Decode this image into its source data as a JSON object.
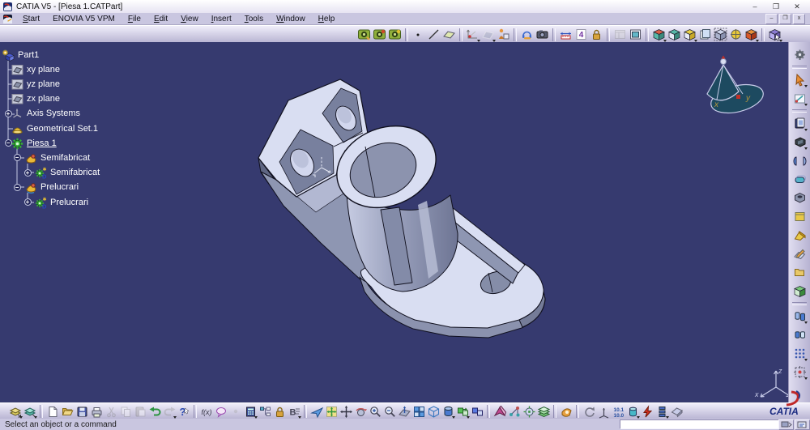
{
  "window": {
    "title": "CATIA V5 - [Piesa 1.CATPart]",
    "controls": {
      "minimize": "–",
      "restore": "❒",
      "close": "✕"
    },
    "mdi_controls": {
      "minimize": "–",
      "restore": "❒",
      "close": "x"
    }
  },
  "menubar": {
    "items": [
      {
        "label": "Start",
        "accel": 0
      },
      {
        "label": "ENOVIA V5 VPM",
        "accel": -1
      },
      {
        "label": "File",
        "accel": 0
      },
      {
        "label": "Edit",
        "accel": 0
      },
      {
        "label": "View",
        "accel": 0
      },
      {
        "label": "Insert",
        "accel": 0
      },
      {
        "label": "Tools",
        "accel": 0
      },
      {
        "label": "Window",
        "accel": 0
      },
      {
        "label": "Help",
        "accel": 0
      }
    ]
  },
  "tree": {
    "items": [
      {
        "label": "Part1",
        "depth": 0,
        "icon": "part_root"
      },
      {
        "label": "xy plane",
        "depth": 1,
        "icon": "plane_ic"
      },
      {
        "label": "yz plane",
        "depth": 1,
        "icon": "plane_ic"
      },
      {
        "label": "zx plane",
        "depth": 1,
        "icon": "plane_ic"
      },
      {
        "label": "Axis Systems",
        "depth": 1,
        "icon": "axis_ic",
        "exp": "+"
      },
      {
        "label": "Geometrical Set.1",
        "depth": 1,
        "icon": "geoset_ic"
      },
      {
        "label": "Piesa 1",
        "depth": 1,
        "icon": "gear_grn",
        "exp": "−",
        "underline": true
      },
      {
        "label": "Semifabricat",
        "depth": 2,
        "icon": "body_yel",
        "exp": "−"
      },
      {
        "label": "Semifabricat",
        "depth": 3,
        "icon": "gear_ad",
        "exp": "+"
      },
      {
        "label": "Prelucrari",
        "depth": 2,
        "icon": "body_yel2",
        "exp": "−"
      },
      {
        "label": "Prelucrari",
        "depth": 3,
        "icon": "gear_ad",
        "exp": "+"
      }
    ]
  },
  "toolbars": {
    "top": {
      "items": [
        {
          "name": "workbench-ppr",
          "glyph": "wb1"
        },
        {
          "name": "workbench-process",
          "glyph": "wb2"
        },
        {
          "name": "workbench-resource",
          "glyph": "wb3"
        },
        {
          "sep": true
        },
        {
          "name": "point",
          "glyph": "point"
        },
        {
          "name": "line",
          "glyph": "line"
        },
        {
          "name": "plane",
          "glyph": "plane"
        },
        {
          "sep": true
        },
        {
          "name": "sketcher",
          "glyph": "sketchaxes",
          "dd": true
        },
        {
          "name": "work-on-support",
          "glyph": "planemsg",
          "dd": true
        },
        {
          "name": "manikin",
          "glyph": "person"
        },
        {
          "sep": true
        },
        {
          "name": "instant-collaboration",
          "glyph": "headset"
        },
        {
          "name": "capture",
          "glyph": "camera"
        },
        {
          "sep": true
        },
        {
          "name": "measure",
          "glyph": "measure"
        },
        {
          "name": "annotation",
          "glyph": "text4"
        },
        {
          "name": "lock",
          "glyph": "lock"
        },
        {
          "sep": true
        },
        {
          "name": "window-layout",
          "glyph": "wingray",
          "dis": true
        },
        {
          "name": "window-frame",
          "glyph": "winframe"
        },
        {
          "sep": true
        },
        {
          "name": "view-mode-shading",
          "glyph": "cube_red",
          "dd": true
        },
        {
          "name": "view-mode-edges",
          "glyph": "cube_teal"
        },
        {
          "name": "view-mode-hidden",
          "glyph": "cube_yel",
          "dd": true
        },
        {
          "name": "view-mode-material",
          "glyph": "cube_pages"
        },
        {
          "name": "view-mode-wireframe",
          "glyph": "cube_frame"
        },
        {
          "name": "view-target",
          "glyph": "target"
        },
        {
          "name": "view-mode-custom",
          "glyph": "cube_org",
          "dd": true
        },
        {
          "sep": true
        },
        {
          "name": "view-cursor",
          "glyph": "cube_cur",
          "dd": true
        }
      ]
    },
    "right": {
      "items": [
        {
          "name": "update",
          "glyph": "gearD"
        },
        {
          "sep": true
        },
        {
          "name": "select",
          "glyph": "cursoror",
          "dd": true
        },
        {
          "name": "sketcher-pad",
          "glyph": "sketchpad",
          "dd": true
        },
        {
          "sep": true
        },
        {
          "name": "pad",
          "glyph": "padblue",
          "dd": true
        },
        {
          "name": "pocket",
          "glyph": "pocketblk",
          "dd": true
        },
        {
          "name": "shaft",
          "glyph": "shaftpair"
        },
        {
          "name": "slot",
          "glyph": "slotteal"
        },
        {
          "name": "hole",
          "glyph": "holebox"
        },
        {
          "name": "stiffener",
          "glyph": "stiffyel"
        },
        {
          "name": "wedge",
          "glyph": "wedgeyel"
        },
        {
          "name": "surface-sketch",
          "glyph": "pencilplane"
        },
        {
          "name": "assemble",
          "glyph": "foldery"
        },
        {
          "name": "boolean-box",
          "glyph": "grnbox"
        },
        {
          "sep": true
        },
        {
          "name": "transformation",
          "glyph": "cyls2",
          "dd": true
        },
        {
          "name": "mirror",
          "glyph": "cylpair"
        },
        {
          "name": "pattern",
          "glyph": "dotgrid",
          "dd": true
        },
        {
          "name": "scaling",
          "glyph": "targetsq",
          "dd": true
        }
      ]
    },
    "bottom": {
      "items": [
        {
          "name": "catalog-browser",
          "glyph": "catalog1",
          "dd": true
        },
        {
          "name": "catalog-library",
          "glyph": "catalog2",
          "dd": true
        },
        {
          "sep": true
        },
        {
          "name": "new-document",
          "glyph": "newdoc"
        },
        {
          "name": "open",
          "glyph": "open"
        },
        {
          "name": "save",
          "glyph": "save"
        },
        {
          "name": "print",
          "glyph": "print"
        },
        {
          "name": "cut",
          "glyph": "cut",
          "dis": true
        },
        {
          "name": "copy",
          "glyph": "copy",
          "dis": true
        },
        {
          "name": "paste",
          "glyph": "paste",
          "dis": true
        },
        {
          "name": "undo",
          "glyph": "undo"
        },
        {
          "name": "redo",
          "glyph": "redo",
          "dis": true,
          "dd": true
        },
        {
          "name": "whats-this",
          "glyph": "helpq"
        },
        {
          "sep": true
        },
        {
          "name": "formula",
          "glyph": "fx"
        },
        {
          "name": "comment",
          "glyph": "speech"
        },
        {
          "name": "knowledge-dot",
          "glyph": "dotg",
          "dis": true
        },
        {
          "name": "design-table",
          "glyph": "calc",
          "dd": true
        },
        {
          "name": "structure-tree",
          "glyph": "hier"
        },
        {
          "name": "lock-parameter",
          "glyph": "lock"
        },
        {
          "name": "parameter-filter",
          "glyph": "bfilter",
          "dd": true
        },
        {
          "sep": true
        },
        {
          "name": "fly-mode",
          "glyph": "fly"
        },
        {
          "name": "fit-all-in",
          "glyph": "fitall"
        },
        {
          "name": "pan",
          "glyph": "pan"
        },
        {
          "name": "rotate",
          "glyph": "rotatev"
        },
        {
          "name": "zoom-in",
          "glyph": "zoomin"
        },
        {
          "name": "zoom-out",
          "glyph": "zoomout"
        },
        {
          "name": "normal-view",
          "glyph": "viewnormal"
        },
        {
          "name": "multi-view",
          "glyph": "multiview"
        },
        {
          "name": "isometric-view",
          "glyph": "isocube"
        },
        {
          "name": "render-style",
          "glyph": "shadedcyl",
          "dd": true
        },
        {
          "name": "hide-show",
          "glyph": "hsgreen",
          "dd": true
        },
        {
          "name": "swap-visible-space",
          "glyph": "hsblue"
        },
        {
          "sep": true
        },
        {
          "name": "analysis-wedge",
          "glyph": "wedgemag"
        },
        {
          "name": "analysis-graph",
          "glyph": "graphteal"
        },
        {
          "name": "analysis-sphere",
          "glyph": "spheretgt"
        },
        {
          "name": "layer-filter",
          "glyph": "layers"
        },
        {
          "sep": true
        },
        {
          "name": "catalog-hand",
          "glyph": "handcat"
        },
        {
          "sep": true
        },
        {
          "name": "refresh",
          "glyph": "circarrow"
        },
        {
          "name": "axis-system",
          "glyph": "axes3"
        },
        {
          "name": "dimension-values",
          "glyph": "nums"
        },
        {
          "name": "body-tool",
          "glyph": "cylteal",
          "dd": true
        },
        {
          "name": "knowledge-bolt",
          "glyph": "bolt"
        },
        {
          "name": "stack-tool",
          "glyph": "stack",
          "dd": true
        },
        {
          "name": "prism-tool",
          "glyph": "prism"
        }
      ]
    }
  },
  "statusbar": {
    "message": "Select an object or a command",
    "command_value": ""
  },
  "viewport": {
    "background": "#363a6f",
    "compass": {
      "x": "x",
      "y": "y"
    },
    "triad": {
      "x": "x",
      "y": "y",
      "z": "z"
    },
    "part_colors": {
      "light": "#d9def2",
      "mid": "#8e96b2",
      "dark": "#6f7694",
      "outline": "#10101e"
    }
  },
  "logo": {
    "text": "CATIA"
  }
}
